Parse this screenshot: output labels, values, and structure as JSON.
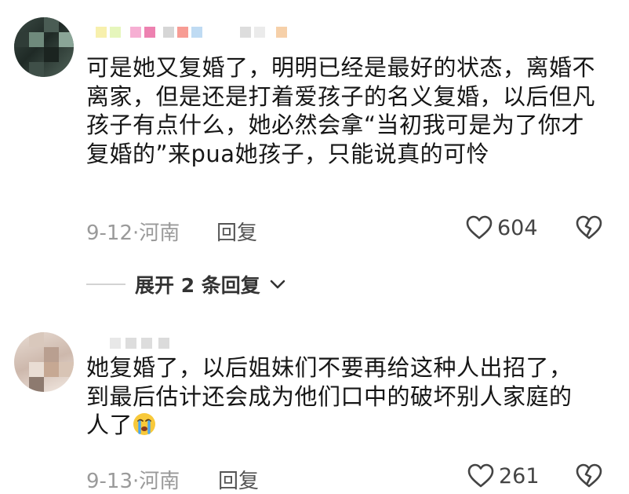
{
  "comments": [
    {
      "text": "可是她又复婚了，明明已经是最好的状态，离婚不离家，但是还是打着爱孩子的名义复婚，以后但凡孩子有点什么，她必然会拿“当初我可是为了你才复婚的”来pua她孩子，只能说真的可怜",
      "date_location": "9-12·河南",
      "reply_label": "回复",
      "likes": "604"
    },
    {
      "text": "她复婚了，以后姐妹们不要再给这种人出招了，到最后估计还会成为他们口中的破坏别人家庭的人了",
      "emoji": "crying-face-emoji",
      "date_location": "9-13·河南",
      "reply_label": "回复",
      "likes": "261"
    }
  ],
  "expand_replies": "展开 2 条回复",
  "colors": {
    "text": "#161616",
    "meta": "#9a9a9a",
    "icon": "#444444"
  }
}
